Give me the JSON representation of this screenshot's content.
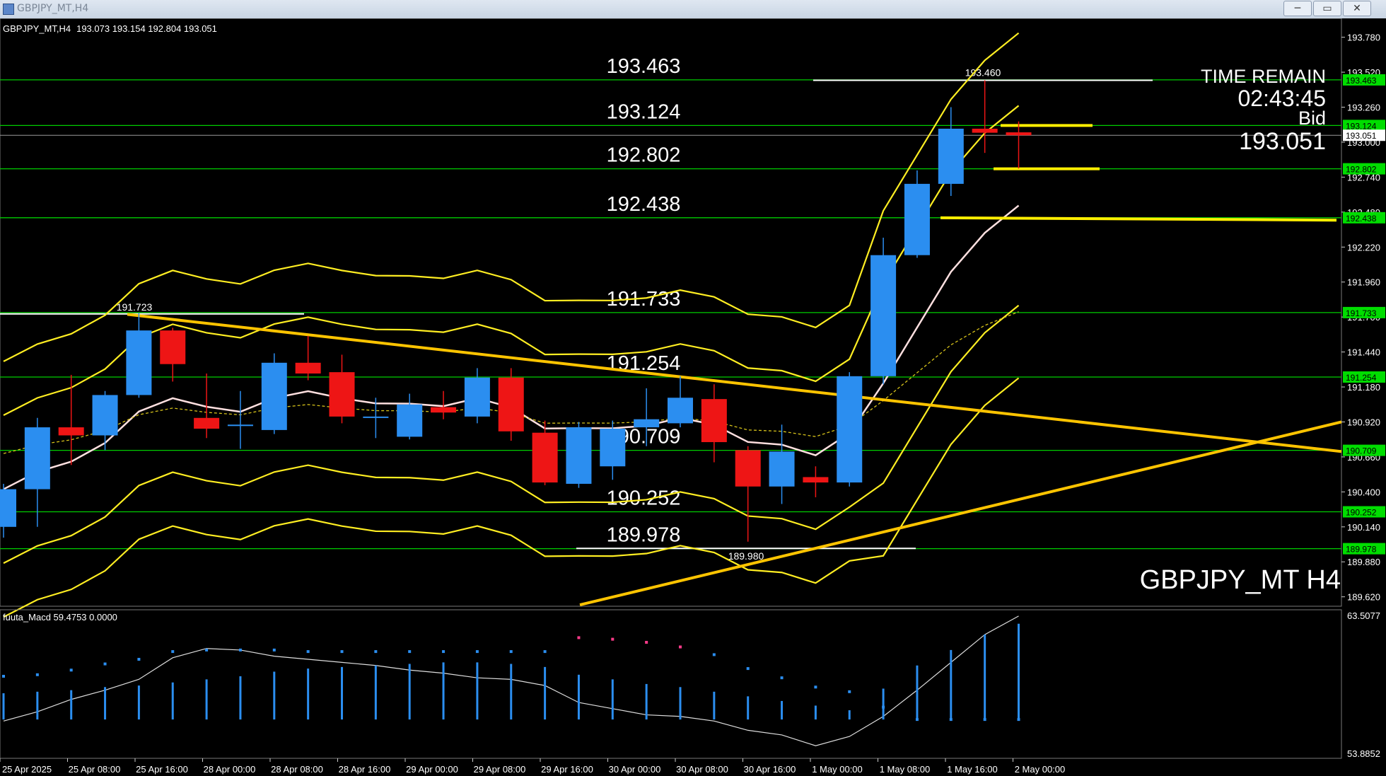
{
  "window": {
    "title": "GBPJPY_MT,H4",
    "minimize": "─",
    "restore": "▭",
    "close": "✕"
  },
  "header": {
    "symbol_info": "GBPJPY_MT,H4",
    "ohlc": "193.073 193.154 192.804 193.051"
  },
  "symbol_watermark": "GBPJPY_MT H4",
  "time_remain": {
    "label": "TIME REMAIN",
    "value": "02:43:45",
    "bid_label": "Bid",
    "bid_value": "193.051"
  },
  "colors": {
    "bull": "#2b8ef0",
    "bear": "#ee1515",
    "band": "#ffee22",
    "trend": "#ffc400",
    "level": "#00cc00",
    "grid": "#ffffff"
  },
  "chart_data": {
    "type": "candlestick",
    "symbol": "GBPJPY_MT",
    "timeframe": "H4",
    "ylim": [
      189.55,
      193.92
    ],
    "y_ticks": [
      "193.780",
      "193.520",
      "193.260",
      "193.000",
      "192.740",
      "192.480",
      "192.220",
      "191.960",
      "191.700",
      "191.440",
      "191.180",
      "190.920",
      "190.660",
      "190.400",
      "190.140",
      "189.880",
      "189.620"
    ],
    "x_labels": [
      "25 Apr 2025",
      "25 Apr 08:00",
      "25 Apr 16:00",
      "28 Apr 00:00",
      "28 Apr 08:00",
      "28 Apr 16:00",
      "29 Apr 00:00",
      "29 Apr 08:00",
      "29 Apr 16:00",
      "30 Apr 00:00",
      "30 Apr 08:00",
      "30 Apr 16:00",
      "1 May 00:00",
      "1 May 08:00",
      "1 May 16:00",
      "2 May 00:00"
    ],
    "candles": [
      {
        "o": 190.14,
        "h": 190.46,
        "l": 190.06,
        "c": 190.42
      },
      {
        "o": 190.42,
        "h": 190.95,
        "l": 190.14,
        "c": 190.88
      },
      {
        "o": 190.88,
        "h": 191.27,
        "l": 190.6,
        "c": 190.82
      },
      {
        "o": 190.82,
        "h": 191.15,
        "l": 190.71,
        "c": 191.12
      },
      {
        "o": 191.12,
        "h": 191.73,
        "l": 191.1,
        "c": 191.6
      },
      {
        "o": 191.6,
        "h": 191.62,
        "l": 191.22,
        "c": 191.35
      },
      {
        "o": 190.95,
        "h": 191.28,
        "l": 190.8,
        "c": 190.87
      },
      {
        "o": 190.89,
        "h": 191.15,
        "l": 190.72,
        "c": 190.9
      },
      {
        "o": 190.86,
        "h": 191.43,
        "l": 190.83,
        "c": 191.36
      },
      {
        "o": 191.36,
        "h": 191.56,
        "l": 191.23,
        "c": 191.28
      },
      {
        "o": 191.29,
        "h": 191.42,
        "l": 190.91,
        "c": 190.96
      },
      {
        "o": 190.95,
        "h": 191.1,
        "l": 190.8,
        "c": 190.96
      },
      {
        "o": 190.81,
        "h": 191.13,
        "l": 190.79,
        "c": 191.05
      },
      {
        "o": 191.03,
        "h": 191.15,
        "l": 190.94,
        "c": 190.99
      },
      {
        "o": 190.96,
        "h": 191.32,
        "l": 190.91,
        "c": 191.25
      },
      {
        "o": 191.25,
        "h": 191.32,
        "l": 190.78,
        "c": 190.85
      },
      {
        "o": 190.84,
        "h": 190.93,
        "l": 190.45,
        "c": 190.47
      },
      {
        "o": 190.46,
        "h": 190.92,
        "l": 190.43,
        "c": 190.88
      },
      {
        "o": 190.59,
        "h": 190.93,
        "l": 190.49,
        "c": 190.87
      },
      {
        "o": 190.88,
        "h": 191.17,
        "l": 190.74,
        "c": 190.94
      },
      {
        "o": 190.91,
        "h": 191.26,
        "l": 190.88,
        "c": 191.1
      },
      {
        "o": 191.09,
        "h": 191.2,
        "l": 190.62,
        "c": 190.77
      },
      {
        "o": 190.71,
        "h": 190.74,
        "l": 190.03,
        "c": 190.44
      },
      {
        "o": 190.44,
        "h": 190.9,
        "l": 190.31,
        "c": 190.7
      },
      {
        "o": 190.51,
        "h": 190.59,
        "l": 190.36,
        "c": 190.47
      },
      {
        "o": 190.47,
        "h": 191.29,
        "l": 190.44,
        "c": 191.26
      },
      {
        "o": 191.26,
        "h": 192.29,
        "l": 191.2,
        "c": 192.16
      },
      {
        "o": 192.16,
        "h": 192.79,
        "l": 192.14,
        "c": 192.69
      },
      {
        "o": 192.69,
        "h": 193.26,
        "l": 192.6,
        "c": 193.1
      },
      {
        "o": 193.1,
        "h": 193.46,
        "l": 192.92,
        "c": 193.07
      },
      {
        "o": 193.073,
        "h": 193.154,
        "l": 192.804,
        "c": 193.051
      }
    ],
    "levels": [
      193.463,
      193.124,
      192.802,
      192.438,
      191.733,
      191.254,
      190.709,
      190.252,
      189.978
    ],
    "level_labels": [
      "193.463",
      "193.124",
      "192.802",
      "192.438",
      "191.733",
      "191.254",
      "190.709",
      "190.252",
      "189.978"
    ],
    "extreme_labels": {
      "high_1": "193.460",
      "high_2": "191.723",
      "low_1": "189.980"
    },
    "macd": {
      "title": "fuuta_Macd 59.4753  0.0000",
      "ylim": [
        53.8852,
        63.5077
      ],
      "y_top": "63.5077",
      "y_bottom": "53.8852",
      "line": [
        56.3,
        56.9,
        57.7,
        58.3,
        59.0,
        60.4,
        61.0,
        60.9,
        60.5,
        60.3,
        60.1,
        59.9,
        59.6,
        59.4,
        59.1,
        59.0,
        58.6,
        57.5,
        57.1,
        56.7,
        56.6,
        56.3,
        55.7,
        55.4,
        54.7,
        55.3,
        56.6,
        58.3,
        60.1,
        61.9,
        63.1
      ],
      "hist": [
        58.1,
        58.2,
        58.3,
        58.5,
        58.6,
        58.8,
        59.0,
        59.2,
        59.5,
        59.7,
        59.8,
        59.9,
        60.0,
        60.1,
        60.1,
        60.0,
        59.8,
        59.3,
        59.0,
        58.7,
        58.5,
        58.2,
        57.9,
        57.6,
        57.3,
        57.0,
        58.4,
        59.9,
        60.9,
        61.9,
        62.6
      ],
      "signal": [
        59.2,
        59.3,
        59.6,
        60.0,
        60.3,
        60.8,
        60.9,
        60.9,
        60.9,
        60.8,
        60.8,
        60.8,
        60.8,
        60.8,
        60.8,
        60.8,
        60.8,
        61.7,
        61.6,
        61.4,
        61.1,
        60.6,
        59.7,
        59.1,
        58.5,
        58.2,
        57.2,
        56.4,
        56.4,
        56.4,
        56.4
      ],
      "y_ref": 56.4
    }
  }
}
